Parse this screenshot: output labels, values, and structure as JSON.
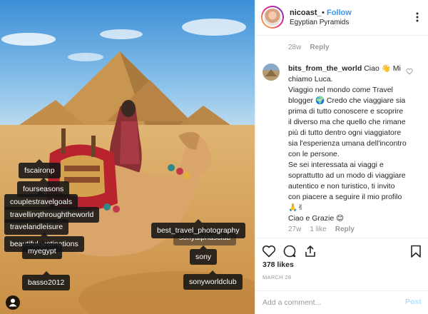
{
  "post": {
    "username": "nicoast_",
    "separator": "•",
    "follow_label": "Follow",
    "location": "Egyptian Pyramids"
  },
  "photo_tags": [
    "fscaironp",
    "fourseasons",
    "couplestravelgoals",
    "travellingthroughtheworld",
    "travelandleisure",
    "beautifuldestinations",
    "myegypt",
    "basso2012",
    "best_travel_photography",
    "sonyalphasclub",
    "sony",
    "sonyworldclub"
  ],
  "previous_comment_meta": {
    "age": "28w",
    "reply_label": "Reply"
  },
  "comment": {
    "username": "bits_from_the_world",
    "text": "Ciao 👋 Mi chiamo Luca.\nViaggio nel mondo come Travel blogger 🌍 Credo che viaggiare sia prima di tutto conoscere e scoprire il diverso ma che quello che rimane più di tutto dentro ogni viaggiatore sia l'esperienza umana dell'incontro con le persone.\nSe sei interessata ai viaggi e soprattutto ad un modo di viaggiare autentico e non turistico, ti invito con piacere a seguire il mio profilo 🙏✌\nCiao e Grazie 😊",
    "age": "27w",
    "likes": "1 like",
    "reply_label": "Reply"
  },
  "actions": {
    "icons": [
      "heart-icon",
      "comment-icon",
      "share-icon",
      "bookmark-icon"
    ]
  },
  "likes_text": "378 likes",
  "date_text": "MARCH 28",
  "comment_box": {
    "placeholder": "Add a comment...",
    "post_label": "Post"
  },
  "colors": {
    "link_blue": "#3897f0",
    "post_disabled": "#b2dffc",
    "meta_gray": "#999999"
  }
}
